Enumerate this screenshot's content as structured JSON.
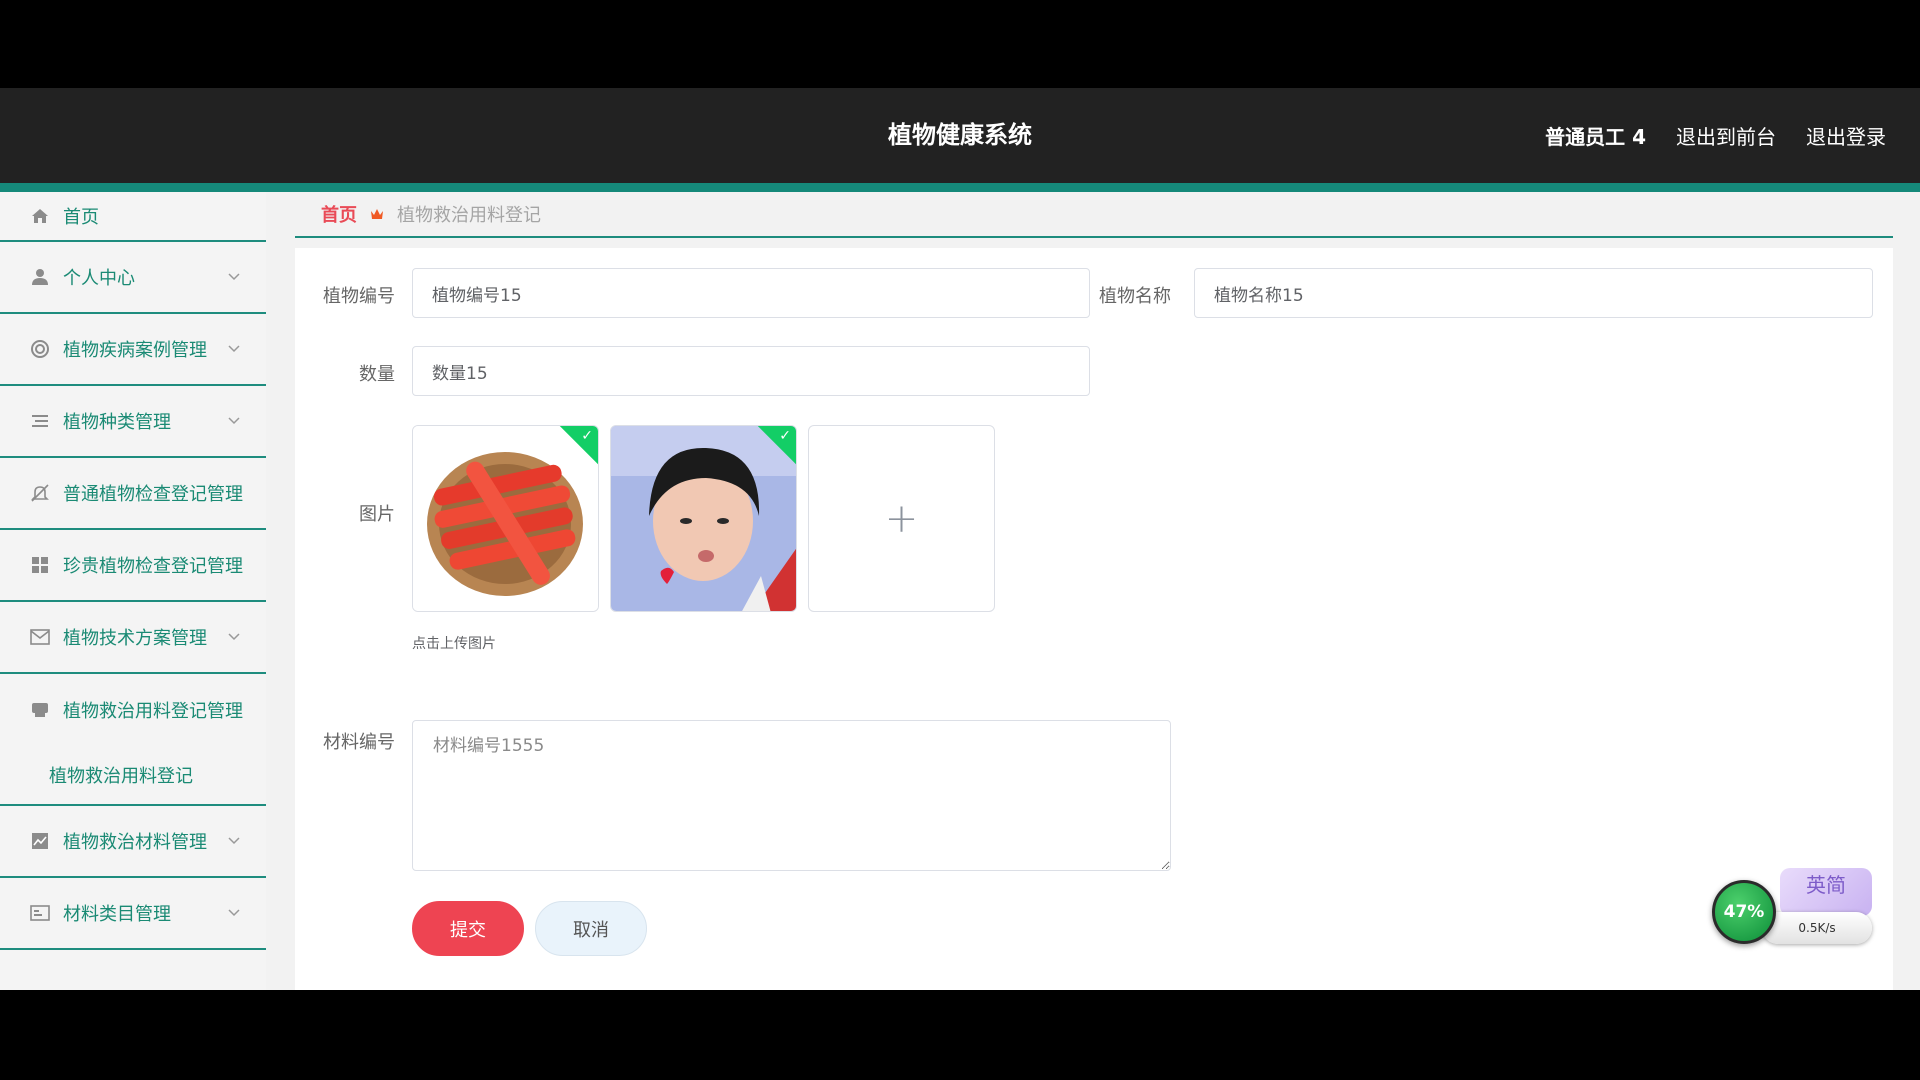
{
  "header": {
    "title": "植物健康系统",
    "user": "普通员工 4",
    "to_front": "退出到前台",
    "logout": "退出登录"
  },
  "sidebar": {
    "items": [
      {
        "label": "首页",
        "icon": "home-icon"
      },
      {
        "label": "个人中心",
        "icon": "user-icon"
      },
      {
        "label": "植物疾病案例管理",
        "icon": "lifebuoy-icon"
      },
      {
        "label": "植物种类管理",
        "icon": "list-icon"
      },
      {
        "label": "普通植物检查登记管理",
        "icon": "bell-off-icon"
      },
      {
        "label": "珍贵植物检查登记管理",
        "icon": "grid-icon"
      },
      {
        "label": "植物技术方案管理",
        "icon": "mail-icon"
      },
      {
        "label": "植物救治用料登记管理",
        "icon": "printer-icon"
      },
      {
        "label": "植物救治材料管理",
        "icon": "chart-icon"
      },
      {
        "label": "材料类目管理",
        "icon": "id-card-icon"
      }
    ],
    "sub_item": "植物救治用料登记"
  },
  "breadcrumb": {
    "home": "首页",
    "current": "植物救治用料登记"
  },
  "form": {
    "plant_code_label": "植物编号",
    "plant_code_value": "植物编号15",
    "plant_name_label": "植物名称",
    "plant_name_value": "植物名称15",
    "quantity_label": "数量",
    "quantity_value": "数量15",
    "image_label": "图片",
    "upload_hint": "点击上传图片",
    "material_code_label": "材料编号",
    "material_code_value": "材料编号1555",
    "submit": "提交",
    "cancel": "取消"
  },
  "tray_widget": {
    "percent": "47%",
    "speed": "0.5K/s",
    "ime": "英简"
  },
  "colors": {
    "accent": "#15897a",
    "submit": "#ee4452",
    "breadcrumb_home": "#e94b57"
  }
}
